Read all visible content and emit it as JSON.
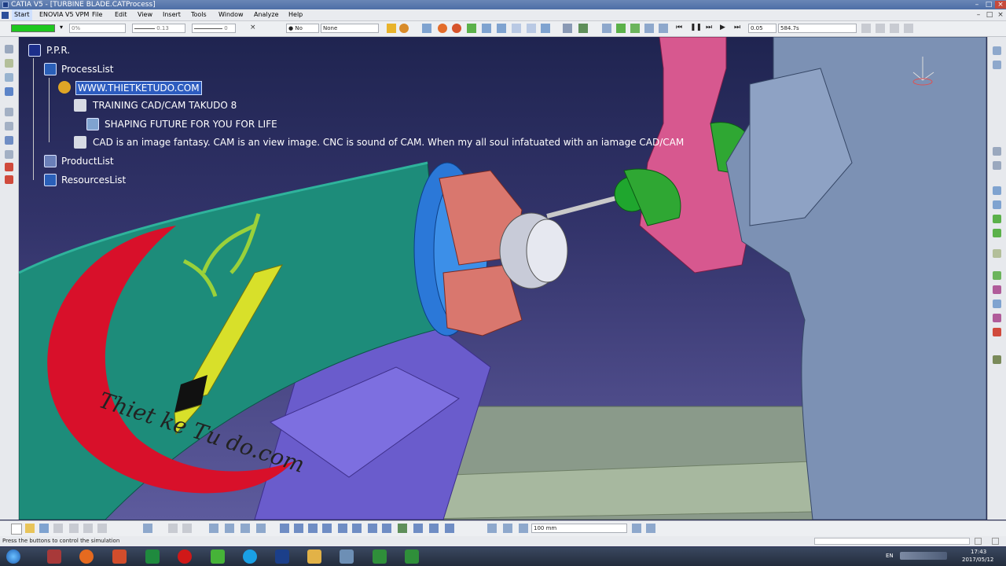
{
  "window": {
    "title": "CATIA V5 - [TURBINE BLADE.CATProcess]"
  },
  "menu": [
    "Start",
    "ENOVIA V5 VPM",
    "File",
    "Edit",
    "View",
    "Insert",
    "Tools",
    "Window",
    "Analyze",
    "Help"
  ],
  "toolbar": {
    "color_fill": "#1ec81e",
    "transparency_value": "0%",
    "line_weight_value": "0.13",
    "line_type_value": "0",
    "layer_value": "No",
    "render_style_value": "None",
    "sim_step_value": "0.05",
    "sim_time_value": "584.7s"
  },
  "tree": {
    "root": "P.P.R.",
    "process_list": "ProcessList",
    "process_item": "WWW.THIETKETUDO.COM",
    "training": "TRAINING CAD/CAM TAKUDO 8",
    "shaping": "SHAPING FUTURE FOR YOU FOR LIFE",
    "quote": "CAD is an image fantasy. CAM is an view image. CNC is sound of CAM. When my all soul infatuated with an iamage CAD/CAM",
    "product_list": "ProductList",
    "resources_list": "ResourcesList"
  },
  "watermark": {
    "text": "Thiet ke Tu do.com"
  },
  "bottom": {
    "distance": "100 mm"
  },
  "status": {
    "text": "Press the buttons to control the simulation"
  },
  "taskbar": {
    "lang": "EN",
    "time": "17:43",
    "date": "2017/05/12"
  },
  "colors": {
    "viewport_bg": "#2b2f68",
    "selection": "#2d5cbf",
    "logo_red": "#d8102a",
    "logo_yellow": "#d8e02a"
  }
}
